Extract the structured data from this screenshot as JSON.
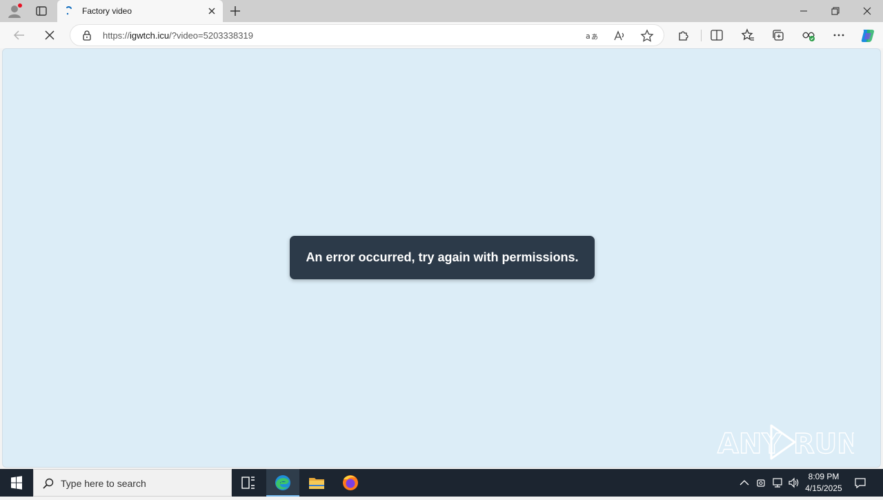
{
  "browser": {
    "tab": {
      "title": "Factory video"
    },
    "address": {
      "scheme": "https://",
      "host": "igwtch.icu",
      "path": "/?video=5203338319"
    }
  },
  "page": {
    "message": "An error occurred, try again with permissions.",
    "watermark": "ANY RUN"
  },
  "taskbar": {
    "search_placeholder": "Type here to search",
    "time": "8:09 PM",
    "date": "4/15/2025"
  },
  "colors": {
    "page_background": "#dcedf7",
    "toast_background": "#2c3a49",
    "taskbar_background": "#1c2530",
    "accent": "#0f6cbd"
  }
}
